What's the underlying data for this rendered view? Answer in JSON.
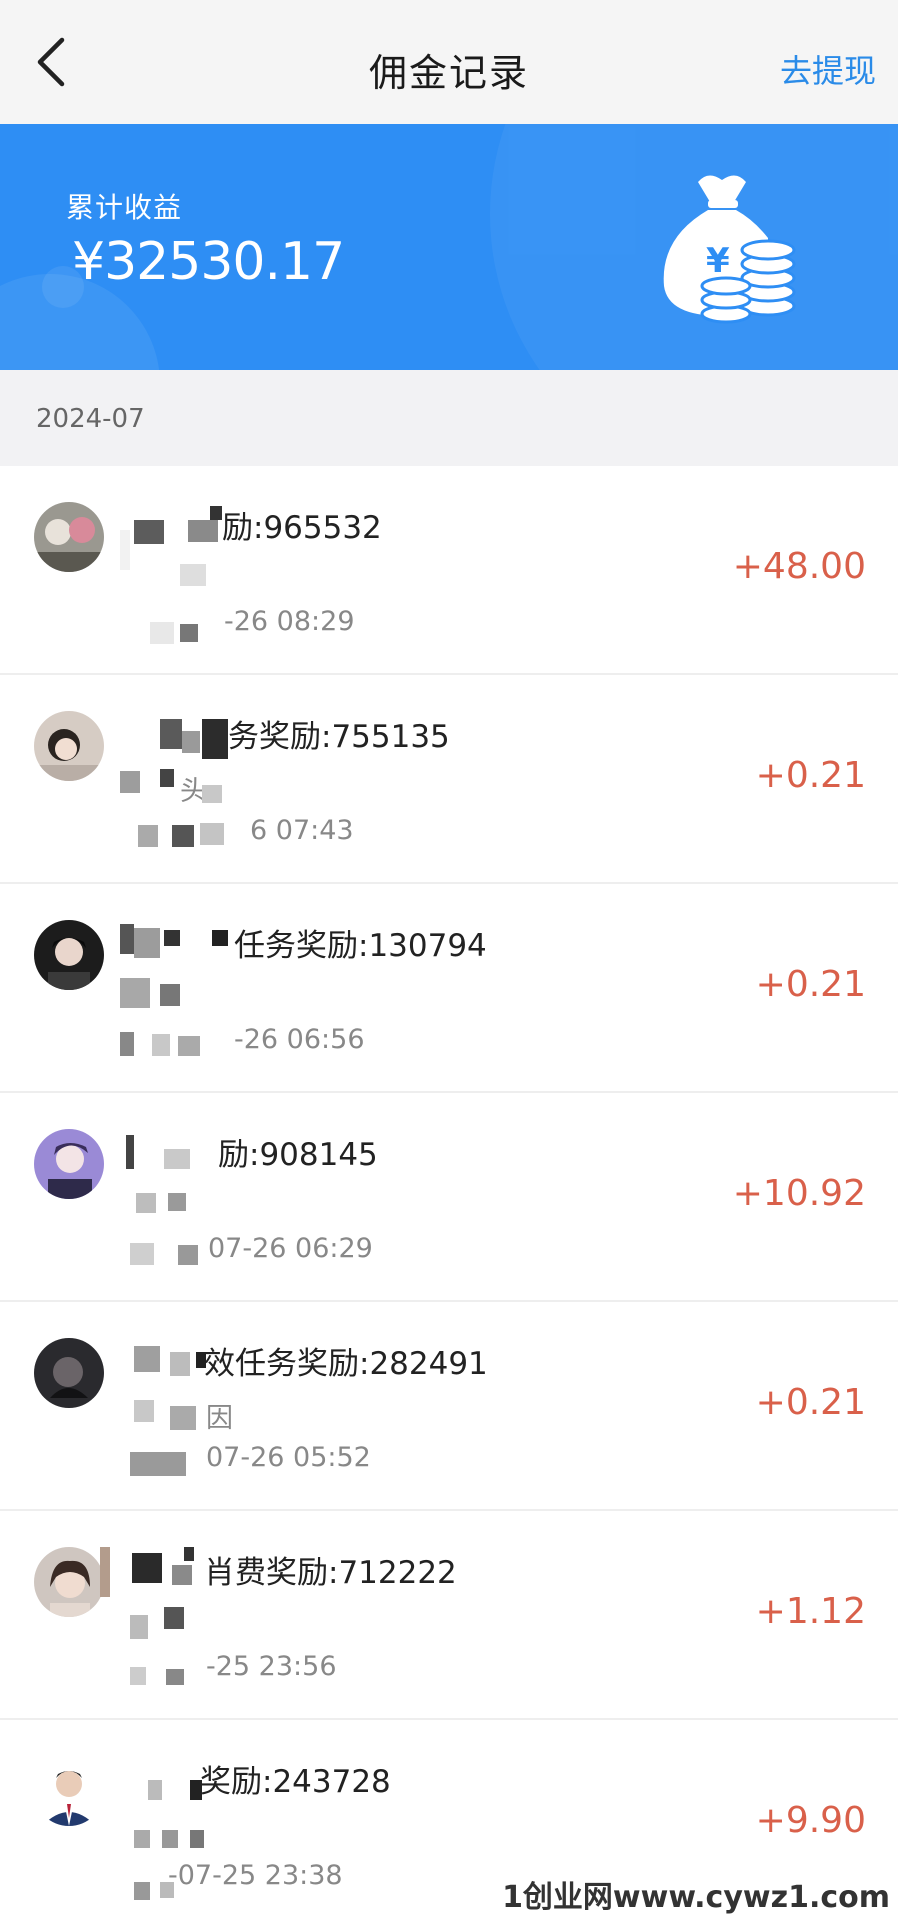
{
  "header": {
    "title": "佣金记录",
    "withdraw_label": "去提现"
  },
  "summary": {
    "label": "累计收益",
    "value": "¥32530.17"
  },
  "date_group": "2024-07",
  "records": [
    {
      "title": "励:965532",
      "subtitle": "",
      "time": "-26 08:29",
      "amount": "+48.00"
    },
    {
      "title": "务奖励:755135",
      "subtitle": "头",
      "time": "6 07:43",
      "amount": "+0.21"
    },
    {
      "title": "任务奖励:130794",
      "subtitle": "",
      "time": "-26 06:56",
      "amount": "+0.21"
    },
    {
      "title": "励:908145",
      "subtitle": "",
      "time": "07-26 06:29",
      "amount": "+10.92"
    },
    {
      "title": "效任务奖励:282491",
      "subtitle": "因",
      "time": "07-26 05:52",
      "amount": "+0.21"
    },
    {
      "title": "肖费奖励:712222",
      "subtitle": "",
      "time": "-25 23:56",
      "amount": "+1.12"
    },
    {
      "title": "奖励:243728",
      "subtitle": "",
      "time": "-07-25 23:38",
      "amount": "+9.90"
    }
  ],
  "watermark": "1创业网www.cywz1.com",
  "colors": {
    "accent": "#2e8ef4",
    "link": "#2a8be8",
    "amount": "#d9604a"
  }
}
